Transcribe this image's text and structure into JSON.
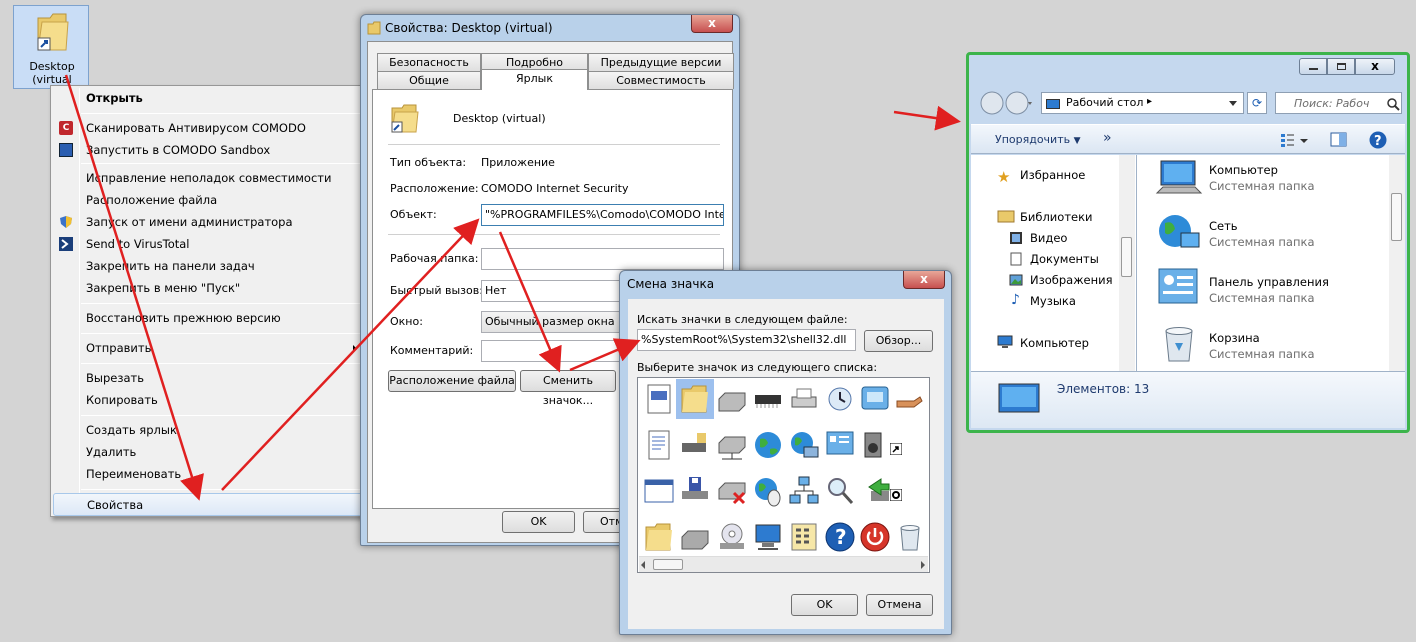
{
  "desktop_icon": {
    "label_line1": "Desktop",
    "label_line2": "(virtual"
  },
  "context_menu": {
    "items": [
      {
        "label": "Открыть"
      },
      {
        "label": "Сканировать Антивирусом COMODO"
      },
      {
        "label": "Запустить в COMODO Sandbox"
      },
      {
        "label": "Исправление неполадок совместимости"
      },
      {
        "label": "Расположение файла"
      },
      {
        "label": "Запуск от имени администратора"
      },
      {
        "label": "Send to VirusTotal"
      },
      {
        "label": "Закрепить на панели задач"
      },
      {
        "label": "Закрепить в меню \"Пуск\""
      },
      {
        "label": "Восстановить прежнюю версию"
      },
      {
        "label": "Отправить"
      },
      {
        "label": "Вырезать"
      },
      {
        "label": "Копировать"
      },
      {
        "label": "Создать ярлык"
      },
      {
        "label": "Удалить"
      },
      {
        "label": "Переименовать"
      },
      {
        "label": "Свойства"
      }
    ]
  },
  "properties": {
    "title": "Свойства: Desktop (virtual)",
    "close": "x",
    "tabs_row1": [
      "Безопасность",
      "Подробно",
      "Предыдущие версии"
    ],
    "tabs_row2": [
      "Общие",
      "Ярлык",
      "Совместимость"
    ],
    "name": "Desktop (virtual)",
    "type_label": "Тип объекта:",
    "type_value": "Приложение",
    "location_label": "Расположение:",
    "location_value": "COMODO Internet Security",
    "target_label": "Объект:",
    "target_value": "\"%PROGRAMFILES%\\Comodo\\COMODO Interne",
    "workdir_label": "Рабочая папка:",
    "workdir_value": "",
    "hotkey_label": "Быстрый вызов:",
    "hotkey_value": "Нет",
    "window_label": "Окно:",
    "window_value": "Обычный размер окна",
    "comment_label": "Комментарий:",
    "comment_value": "",
    "open_location_button": "Расположение файла",
    "change_icon_button": "Сменить значок...",
    "ok_button": "OK",
    "cancel_button_partial": "Отме"
  },
  "change_icon": {
    "title": "Смена значка",
    "close": "x",
    "search_label": "Искать значки в следующем файле:",
    "file_value": "%SystemRoot%\\System32\\shell32.dll",
    "browse_button": "Обзор...",
    "select_label": "Выберите значок из следующего списка:",
    "ok_button": "OK",
    "cancel_button": "Отмена"
  },
  "explorer": {
    "address": "Рабочий стол",
    "search_placeholder": "Поиск: Рабоч",
    "organize_label": "Упорядочить",
    "more_label": "»",
    "nav": {
      "favorites": "Избранное",
      "libraries": "Библиотеки",
      "video": "Видео",
      "documents": "Документы",
      "images": "Изображения",
      "music": "Музыка",
      "computer": "Компьютер"
    },
    "items": [
      {
        "name": "Компьютер",
        "type": "Системная папка"
      },
      {
        "name": "Сеть",
        "type": "Системная папка"
      },
      {
        "name": "Панель управления",
        "type": "Системная папка"
      },
      {
        "name": "Корзина",
        "type": "Системная папка"
      }
    ],
    "status": "Элементов: 13"
  },
  "colors": {
    "arrow": "#e02020",
    "highlight_border": "#3cb44b",
    "accent": "#1e5fb4"
  }
}
